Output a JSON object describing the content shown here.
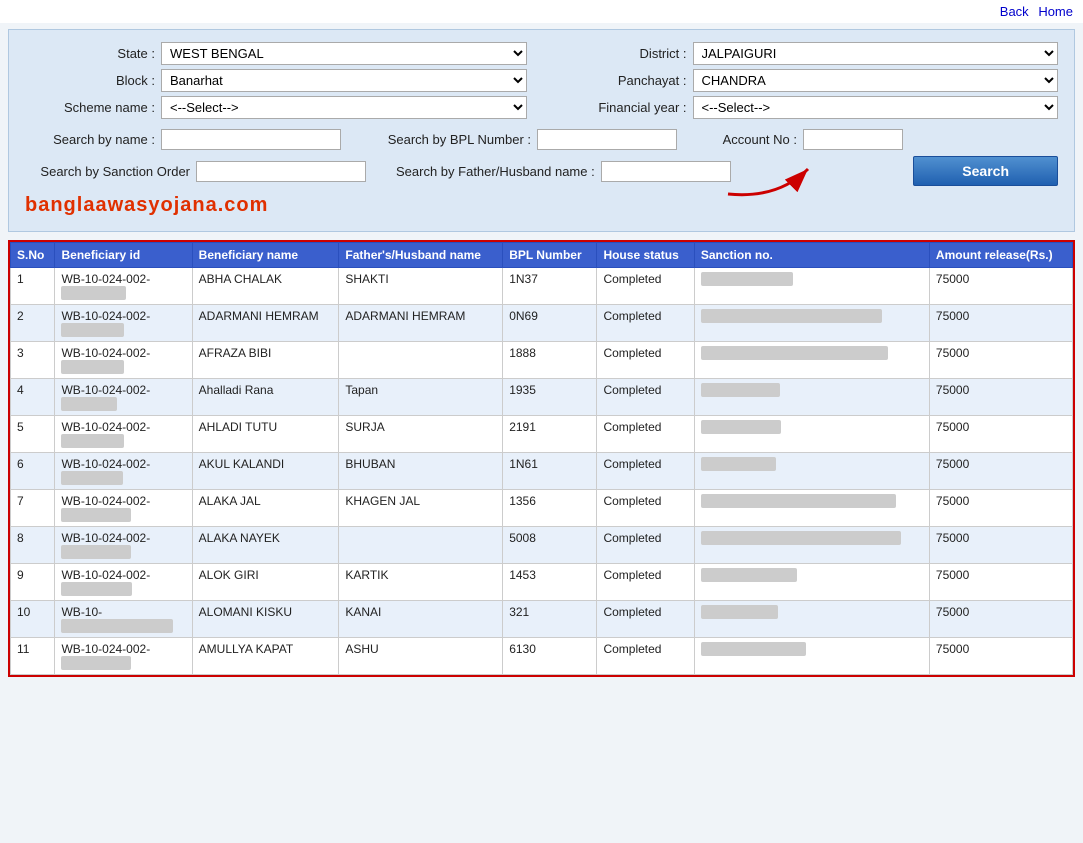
{
  "nav": {
    "back_label": "Back",
    "home_label": "Home"
  },
  "form": {
    "state_label": "State :",
    "state_value": "WEST BENGAL",
    "block_label": "Block :",
    "block_value": "Banarhat",
    "scheme_label": "Scheme name :",
    "scheme_value": "<--Select-->",
    "district_label": "District :",
    "district_value": "JALPAIGURI",
    "panchayat_label": "Panchayat :",
    "panchayat_value": "CHANDRA",
    "financial_year_label": "Financial year :",
    "financial_year_value": "<--Select-->",
    "search_by_name_label": "Search by name :",
    "search_by_name_value": "",
    "search_by_bpl_label": "Search by BPL Number :",
    "search_by_bpl_value": "",
    "account_no_label": "Account No :",
    "account_no_value": "",
    "search_by_sanction_label": "Search by Sanction Order",
    "search_by_sanction_value": "",
    "search_by_father_label": "Search by Father/Husband name :",
    "search_by_father_value": "",
    "search_button": "Search",
    "watermark": "banglaawasyojana.com"
  },
  "table": {
    "headers": [
      "S.No",
      "Beneficiary id",
      "Beneficiary name",
      "Father's/Husband name",
      "BPL Number",
      "House status",
      "Sanction no.",
      "Amount release(Rs.)"
    ],
    "rows": [
      {
        "sno": "1",
        "id": "WB-10-024-002-",
        "id2": "XXXXXXXX",
        "name": "ABHA CHALAK",
        "father": "SHAKTI",
        "bpl": "1N37",
        "status": "Completed",
        "sanction": "161 XXXXXXIDN",
        "amount": "75000"
      },
      {
        "sno": "2",
        "id": "WB-10-024-002-",
        "id2": "0XXXXXXX",
        "name": "ADARMANI HEMRAM",
        "father": "ADARMANI HEMRAM",
        "bpl": "0N69",
        "status": "Completed",
        "sanction": "19/XXXXXXXXX00614/13-14 (I)/6",
        "amount": "75000"
      },
      {
        "sno": "3",
        "id": "WB-10-024-002-",
        "id2": "0XXXXXXX",
        "name": "AFRAZA BIBI",
        "father": "",
        "bpl": "1888",
        "status": "Completed",
        "sanction": "19XXXXXXXXX/100614/13-14 (I)/6",
        "amount": "75000"
      },
      {
        "sno": "4",
        "id": "WB-10-024-002-",
        "id2": "007/XXXX",
        "name": "Ahalladi Rana",
        "father": "Tapan",
        "bpl": "1935",
        "status": "Completed",
        "sanction": "450XXXX 1/14",
        "amount": "75000"
      },
      {
        "sno": "5",
        "id": "WB-10-024-002-",
        "id2": "0XXXXXXX",
        "name": "AHLADI TUTU",
        "father": "SURJA",
        "bpl": "2191",
        "status": "Completed",
        "sanction": "450XXXXX 1/6",
        "amount": "75000"
      },
      {
        "sno": "6",
        "id": "WB-10-024-002-",
        "id2": "XXXXXX61",
        "name": "AKUL KALANDI",
        "father": "BHUBAN",
        "bpl": "1N61",
        "status": "Completed",
        "sanction": "450 XXXX 1/6",
        "amount": "75000"
      },
      {
        "sno": "7",
        "id": "WB-10-024-002-",
        "id2": "01XXXXXXX",
        "name": "ALAKA JAL",
        "father": "KHAGEN JAL",
        "bpl": "1356",
        "status": "Completed",
        "sanction": "19/XXXXXXXXXX, 00614/13-14 (I)/5",
        "amount": "75000"
      },
      {
        "sno": "8",
        "id": "WB-10-024-002-",
        "id2": "01XXXXXXX",
        "name": "ALAKA NAYEK",
        "father": "",
        "bpl": "5008",
        "status": "Completed",
        "sanction": "19/XXXXXXXXXX X00614/13-14 (I)/5",
        "amount": "75000"
      },
      {
        "sno": "9",
        "id": "WB-10-024-002-",
        "id2": "0XXXXXXXX",
        "name": "ALOK GIRI",
        "father": "KARTIK",
        "bpl": "1453",
        "status": "Completed",
        "sanction": "1XXXXXXXXXDN",
        "amount": "75000"
      },
      {
        "sno": "10",
        "id": "WB-10-",
        "id2": "XXXXXXXX-002/321",
        "name": "ALOMANI KISKU",
        "father": "KANAI",
        "bpl": "321",
        "status": "Completed",
        "sanction": "450XXXXX1/6",
        "amount": "75000"
      },
      {
        "sno": "11",
        "id": "WB-10-024-002-",
        "id2": "01XXXXXXX",
        "name": "AMULLYA KAPAT",
        "father": "ASHU",
        "bpl": "6130",
        "status": "Completed",
        "sanction": "XXXXXXXXXXXDN",
        "amount": "75000"
      }
    ]
  }
}
